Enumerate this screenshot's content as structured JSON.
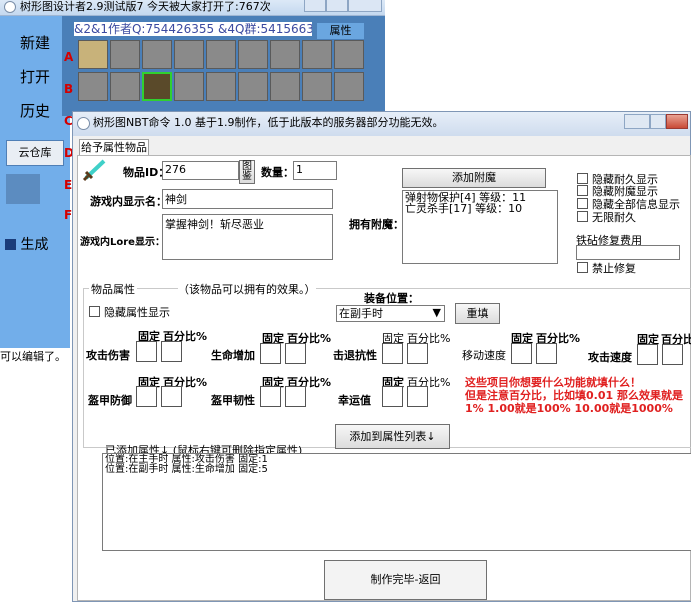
{
  "bg_window": {
    "title": "树形图设计者2.9测试版7 今天被大家打开了:767次",
    "header_text": "&2&1作者Q:754426355 &4Q群:5415663",
    "prop_tab": "属性",
    "side_buttons": [
      "新建",
      "打开",
      "历史"
    ],
    "cloud_button": "云仓库",
    "generate_button": "生成",
    "row_letters": [
      "A",
      "B",
      "C",
      "D",
      "E",
      "F"
    ],
    "edit_hint": "可以编辑了。"
  },
  "dialog": {
    "title": "树形图NBT命令 1.0   基于1.9制作，低于此版本的服务器部分功能无效。",
    "tab": "给予属性物品",
    "item_id_label": "物品ID：",
    "item_id_value": "276",
    "icon_button": "图鉴",
    "count_label": "数量：",
    "count_value": "1",
    "add_enchant_button": "添加附魔",
    "display_name_label": "游戏内显示名：",
    "display_name_value": "神剑",
    "lore_label": "游戏内Lore显示：",
    "lore_value": "掌握神剑！斩尽恶业",
    "enchant_label": "拥有附魔：",
    "enchant_lines": [
      "弹射物保护[4]    等级：11",
      "亡灵杀手[17]    等级：10"
    ],
    "hide_checks": [
      "隐藏耐久显示",
      "隐藏附魔显示",
      "隐藏全部信息显示",
      "无限耐久"
    ],
    "anvil_label": "铁砧修复费用",
    "anvil_value": "",
    "no_repair": "禁止修复",
    "attr_group": "物品属性",
    "attr_note": "（该物品可以拥有的效果。）",
    "hide_attr": "隐藏属性显示",
    "slot_label": "装备位置：",
    "slot_value": "在副手时",
    "reset_button": "重填",
    "fixed": "固定",
    "percent": "百分比%",
    "attrs_row1": [
      "攻击伤害",
      "生命增加",
      "击退抗性",
      "移动速度",
      "攻击速度"
    ],
    "attrs_row2": [
      "盔甲防御",
      "盔甲韧性",
      "幸运值"
    ],
    "warn_lines": [
      "这些项目你想要什么功能就填什么！",
      "但是注意百分比，比如填0.01  那么效果就是",
      "1%  1.00就是100%   10.00就是1000%"
    ],
    "add_list_button": "添加到属性列表↓",
    "added_label": "已添加属性↓    (鼠标右键可删除指定属性)",
    "added_lines": [
      "位置:在主手时    属性:攻击伤害      固定:1",
      "位置:在副手时    属性:生命增加      固定:5"
    ],
    "done_button": "制作完毕-返回"
  },
  "colors": {
    "panel_blue": "#72aeea",
    "warning_red": "#e02020"
  }
}
